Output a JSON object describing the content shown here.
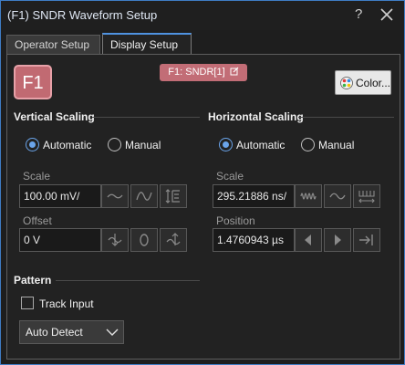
{
  "window": {
    "title": "(F1) SNDR Waveform Setup",
    "help_label": "?"
  },
  "tabs": [
    {
      "label": "Operator Setup"
    },
    {
      "label": "Display Setup"
    }
  ],
  "badge": {
    "label": "F1"
  },
  "source_chip": {
    "label": "F1: SNDR[1]"
  },
  "color_button": {
    "label": "Color..."
  },
  "vertical": {
    "title": "Vertical Scaling",
    "mode_auto": "Automatic",
    "mode_manual": "Manual",
    "scale_label": "Scale",
    "scale_value": "100.00 mV/",
    "offset_label": "Offset",
    "offset_value": "0 V"
  },
  "horizontal": {
    "title": "Horizontal Scaling",
    "mode_auto": "Automatic",
    "mode_manual": "Manual",
    "scale_label": "Scale",
    "scale_value": "295.21886 ns/",
    "position_label": "Position",
    "position_value": "1.4760943 µs"
  },
  "pattern": {
    "title": "Pattern",
    "track_input_label": "Track Input",
    "detect_value": "Auto Detect"
  }
}
